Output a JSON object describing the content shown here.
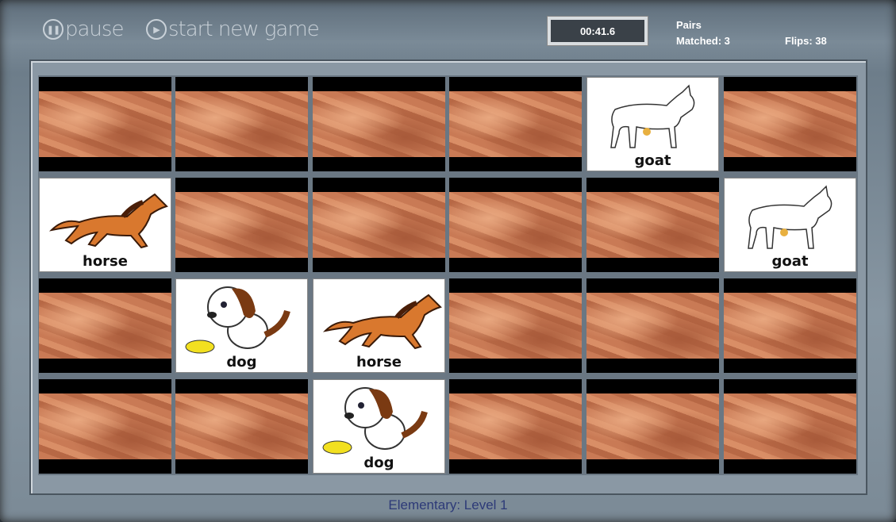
{
  "header": {
    "pause_label": "pause",
    "new_game_label": "start new game",
    "timer": "00:41.6",
    "pairs_label": "Pairs",
    "matched": "Matched: 3",
    "flips": "Flips: 38"
  },
  "board": {
    "rows": 4,
    "cols": 6,
    "cards": [
      {
        "r": 0,
        "c": 4,
        "animal": "goat"
      },
      {
        "r": 1,
        "c": 0,
        "animal": "horse"
      },
      {
        "r": 1,
        "c": 5,
        "animal": "goat"
      },
      {
        "r": 2,
        "c": 1,
        "animal": "dog"
      },
      {
        "r": 2,
        "c": 2,
        "animal": "horse"
      },
      {
        "r": 3,
        "c": 2,
        "animal": "dog"
      }
    ]
  },
  "footer": {
    "level": "Elementary: Level 1"
  },
  "icons": {
    "pause": "pause-circle-icon",
    "play": "play-circle-icon"
  }
}
